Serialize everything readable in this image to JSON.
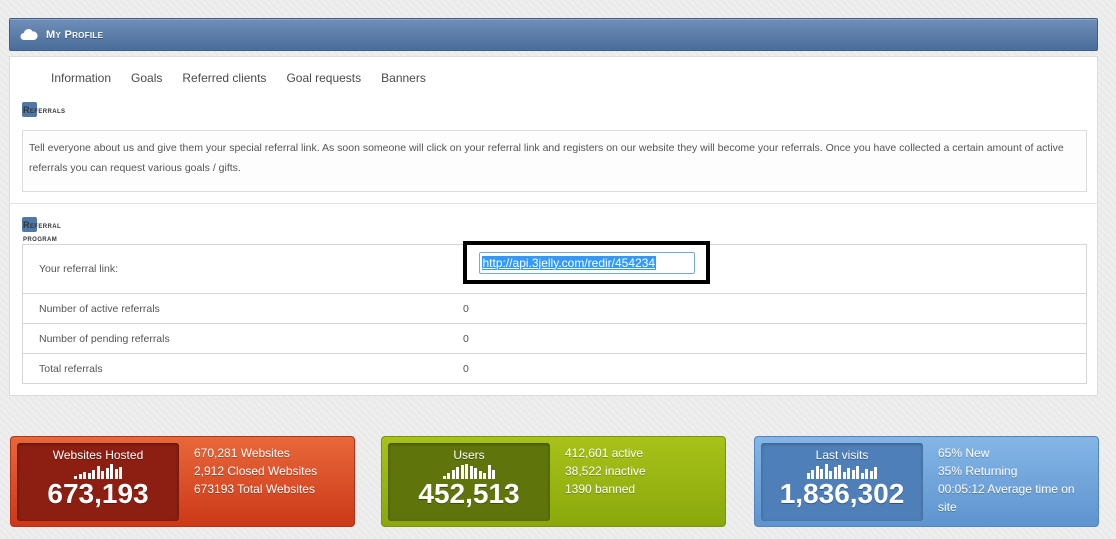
{
  "header": {
    "title": "My Profile",
    "icon": "cloud-icon"
  },
  "tabs": [
    "Information",
    "Goals",
    "Referred clients",
    "Goal requests",
    "Banners"
  ],
  "referrals": {
    "title": "Referrals",
    "text": "Tell everyone about us and give them your special referral link. As soon someone will click on your referral link and registers on our website they will become your referrals. Once you have collected a certain amount of active referrals you can request various goals / gifts."
  },
  "program": {
    "title_line1": "Referral",
    "title_line2": "program",
    "rows": [
      {
        "label": "Your referral link:",
        "value": "http://api.3jelly.com/redir/454234"
      },
      {
        "label": "Number of active referrals",
        "value": "0"
      },
      {
        "label": "Number of pending referrals",
        "value": "0"
      },
      {
        "label": "Total referrals",
        "value": "0"
      }
    ]
  },
  "cards": [
    {
      "label": "Websites Hosted",
      "number": "673,193",
      "stats": [
        "670,281 Websites",
        "2,912 Closed Websites",
        "673193 Total Websites"
      ],
      "color": "#d9461f"
    },
    {
      "label": "Users",
      "number": "452,513",
      "stats": [
        "412,601 active",
        "38,522 inactive",
        "1390 banned"
      ],
      "color": "#9bb814"
    },
    {
      "label": "Last visits",
      "number": "1,836,302",
      "stats": [
        "65% New",
        "35% Returning",
        "00:05:12 Average time on site"
      ],
      "color": "#6fa3dc"
    }
  ]
}
